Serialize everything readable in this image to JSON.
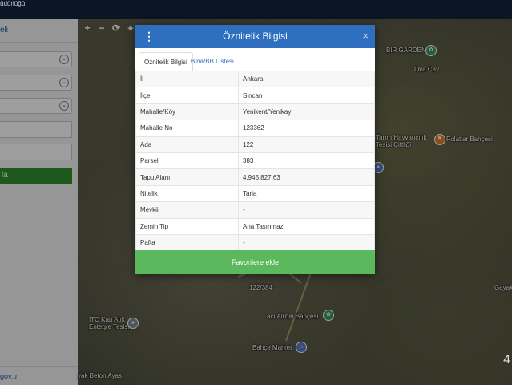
{
  "topbar": {
    "brand_text": "üdürlüğü"
  },
  "sidebar": {
    "link_label": "eli",
    "search_button_label": "la",
    "footer_link": "gov.tr"
  },
  "map": {
    "toolbar": [
      {
        "name": "zoom-in-button",
        "glyph": "+"
      },
      {
        "name": "zoom-out-button",
        "glyph": "−"
      },
      {
        "name": "refresh-button",
        "glyph": "⟳"
      },
      {
        "name": "locate-button",
        "glyph": "⌖"
      }
    ],
    "labels": {
      "bir_garden": "BİR GARDEN",
      "ova_cay": "Ova Çay",
      "tarim": "Tarım Hayvancılık",
      "tesisi": "Tesisi Çiftliği",
      "polatlar": "Polatlar Bahçesi",
      "gayaks": "Gayak",
      "parcel": "122/384",
      "itc": "İTC Katı Atık",
      "entegre": "Entegre Tesisleri",
      "aci": "acı Ali'nin Bahçesi",
      "bahce_market": "Bahçe Market",
      "beton": "yak Beton Ayas",
      "page_num": "4"
    }
  },
  "modal": {
    "title": "Öznitelik Bilgisi",
    "close_glyph": "×",
    "tabs": [
      {
        "label": "Öznitelik Bilgisi"
      },
      {
        "label": "Bina/BB Listesi"
      }
    ],
    "rows": [
      {
        "key": "İl",
        "value": "Ankara"
      },
      {
        "key": "İlçe",
        "value": "Sincan"
      },
      {
        "key": "Mahalle/Köy",
        "value": "Yenikent/Yenikayı"
      },
      {
        "key": "Mahalle No",
        "value": "123362"
      },
      {
        "key": "Ada",
        "value": "122"
      },
      {
        "key": "Parsel",
        "value": "383"
      },
      {
        "key": "Tapu Alanı",
        "value": "4.945.827,63"
      },
      {
        "key": "Nitelik",
        "value": "Tarla"
      },
      {
        "key": "Mevkii",
        "value": "-"
      },
      {
        "key": "Zemin Tip",
        "value": "Ana Taşınmaz"
      },
      {
        "key": "Pafta",
        "value": "-"
      }
    ],
    "favorite_button_label": "Favorilere ekle"
  },
  "colors": {
    "header_blue": "#2f6fbf",
    "favorite_green": "#5cb85c",
    "sidebar_green": "#2f8f2f"
  }
}
